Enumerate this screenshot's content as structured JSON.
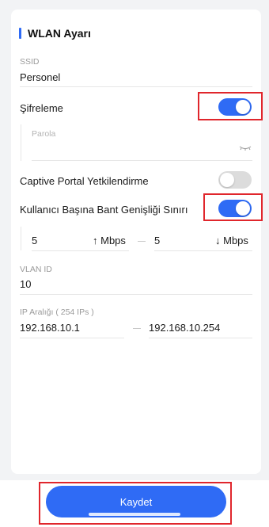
{
  "section": {
    "title": "WLAN Ayarı"
  },
  "ssid": {
    "label": "SSID",
    "value": "Personel"
  },
  "encryption": {
    "label": "Şifreleme",
    "enabled": true
  },
  "password": {
    "placeholder": "Parola",
    "icon": "eye-closed-icon"
  },
  "captive_portal": {
    "label": "Captive Portal Yetkilendirme",
    "enabled": false
  },
  "bandwidth_limit": {
    "label": "Kullanıcı Başına Bant Genişliği Sınırı",
    "enabled": true,
    "upload_value": "5",
    "upload_unit": "↑ Mbps",
    "download_value": "5",
    "download_unit": "↓ Mbps"
  },
  "vlan": {
    "label": "VLAN ID",
    "value": "10"
  },
  "ip_range": {
    "label": "IP Aralığı ( 254  IPs )",
    "start": "192.168.10.1",
    "end": "192.168.10.254"
  },
  "footer": {
    "save_label": "Kaydet"
  },
  "colors": {
    "accent": "#2f6bf5",
    "highlight": "#e0262c",
    "toggle_off": "#dcdcdc"
  }
}
